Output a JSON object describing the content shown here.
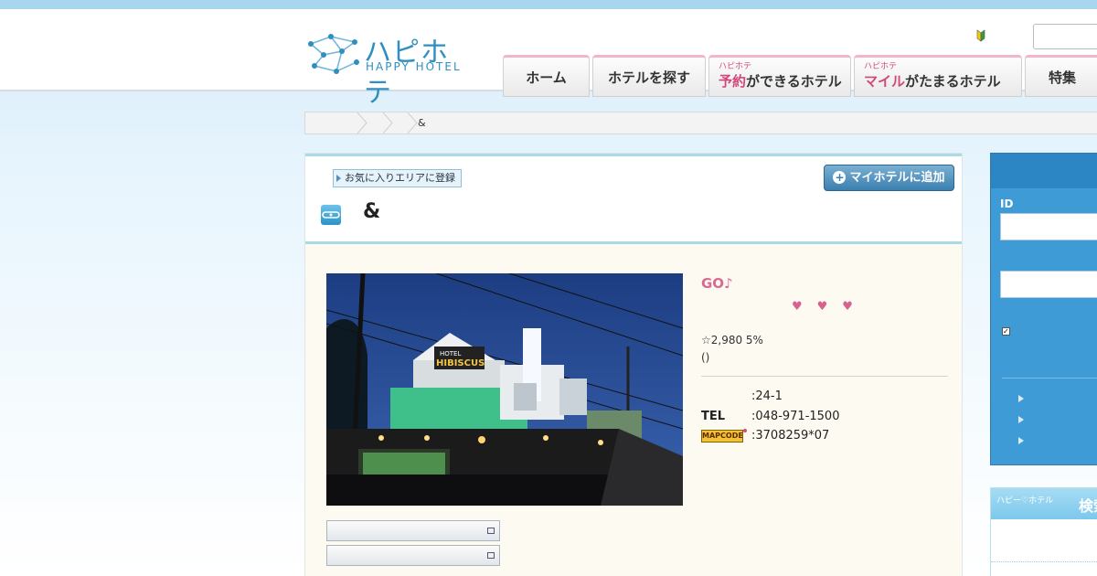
{
  "header": {
    "logo_jp": "ハピホテ",
    "logo_en": "HAPPY HOTEL",
    "nav": [
      {
        "label": "ホーム"
      },
      {
        "label": "ホテルを探す"
      },
      {
        "small": "ハピホテ",
        "highlight": "予約",
        "rest": "ができるホテル"
      },
      {
        "small": "ハピホテ",
        "highlight": "マイル",
        "rest": "がたまるホテル"
      },
      {
        "label": "特集"
      }
    ]
  },
  "breadcrumb": {
    "current": "&"
  },
  "hotel": {
    "favorite_area_label": "お気に入りエリアに登録",
    "add_myhotel_label": "マイホテルに追加",
    "name": "&",
    "catch": "GO♪",
    "hearts": "♥♥♥",
    "price_line": "☆2,980 5%",
    "paren_line": "()",
    "address_value": ":24-1",
    "tel_label": "TEL",
    "tel_value": ":048-971-1500",
    "mapcode_badge": "MAPCODE",
    "mapcode_value": ":3708259*07"
  },
  "login": {
    "id_label": "ID"
  },
  "search": {
    "logo_text": "ハピー♡ホテル",
    "title": "検索"
  },
  "colors": {
    "accent_pink": "#d1477a",
    "brand_blue": "#2f8fc0",
    "login_blue": "#3e9bd6"
  }
}
